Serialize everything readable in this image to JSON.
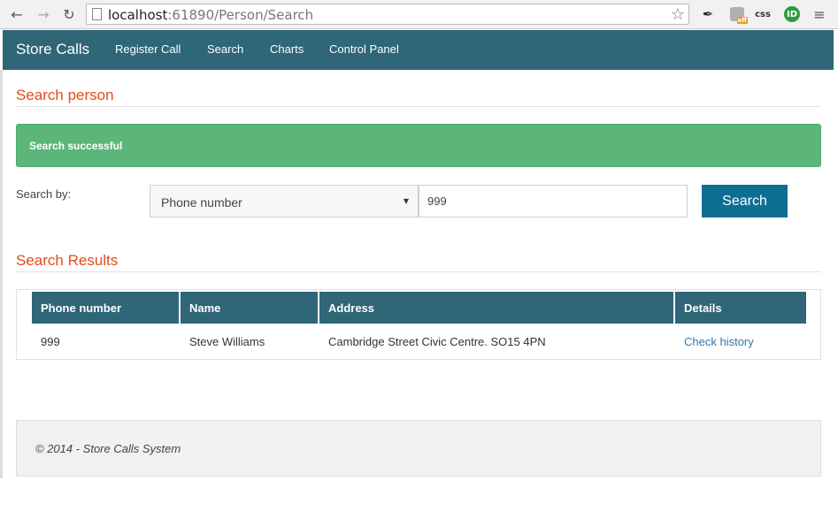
{
  "browser": {
    "url_host": "localhost",
    "url_rest": ":61890/Person/Search",
    "ext_robot_badge": "off",
    "ext_css_label": "css",
    "ext_id_label": "ID"
  },
  "navbar": {
    "brand": "Store Calls",
    "links": [
      "Register Call",
      "Search",
      "Charts",
      "Control Panel"
    ]
  },
  "search_section": {
    "title": "Search person",
    "alert": "Search successful",
    "label": "Search by:",
    "selected_field": "Phone number",
    "query_value": "999",
    "button_label": "Search"
  },
  "results_section": {
    "title": "Search Results",
    "columns": [
      "Phone number",
      "Name",
      "Address",
      "Details"
    ],
    "rows": [
      {
        "phone": "999",
        "name": "Steve Williams",
        "address": "Cambridge Street Civic Centre. SO15 4PN",
        "details_link": "Check history"
      }
    ]
  },
  "footer": {
    "text": "© 2014 - Store Calls System"
  },
  "colors": {
    "navbar": "#2f6678",
    "accent_heading": "#e64a19",
    "alert": "#5cb67a",
    "button": "#0d6e94",
    "link": "#2a7ab0"
  }
}
